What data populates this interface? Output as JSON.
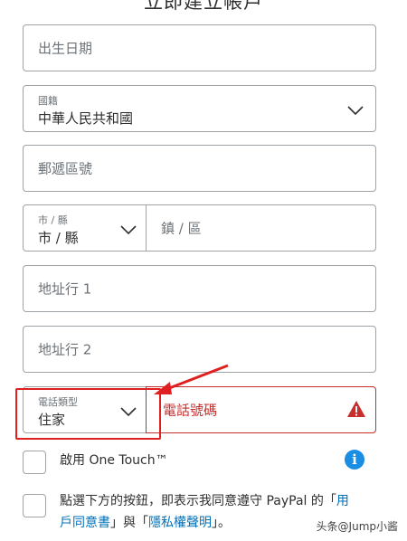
{
  "form": {
    "birthdate": {
      "placeholder": "出生日期"
    },
    "nationality": {
      "label": "國籍",
      "value": "中華人民共和國"
    },
    "postal": {
      "placeholder": "郵遞區號"
    },
    "city": {
      "label": "市 / 縣",
      "value": "市 / 縣"
    },
    "district": {
      "placeholder": "鎮 / 區"
    },
    "address1": {
      "placeholder": "地址行 1"
    },
    "address2": {
      "placeholder": "地址行 2"
    },
    "phone_type": {
      "label": "電話類型",
      "value": "住家"
    },
    "phone_number": {
      "placeholder": "電話號碼"
    }
  },
  "one_touch": {
    "prefix": "啟用 ",
    "brand": "One Touch™"
  },
  "agreement": {
    "line1": "點選下方的按鈕，即表示我同意遵守 PayPal 的「",
    "link1a": "用",
    "link1b": "戶同意書",
    "middle": "」與「",
    "link2": "隱私權聲明",
    "end": "」。"
  },
  "watermark": "头条@Jump小酱",
  "colors": {
    "error": "#c72e2e",
    "link": "#0070ba",
    "info": "#1a8ee3",
    "highlight": "#e02020"
  }
}
